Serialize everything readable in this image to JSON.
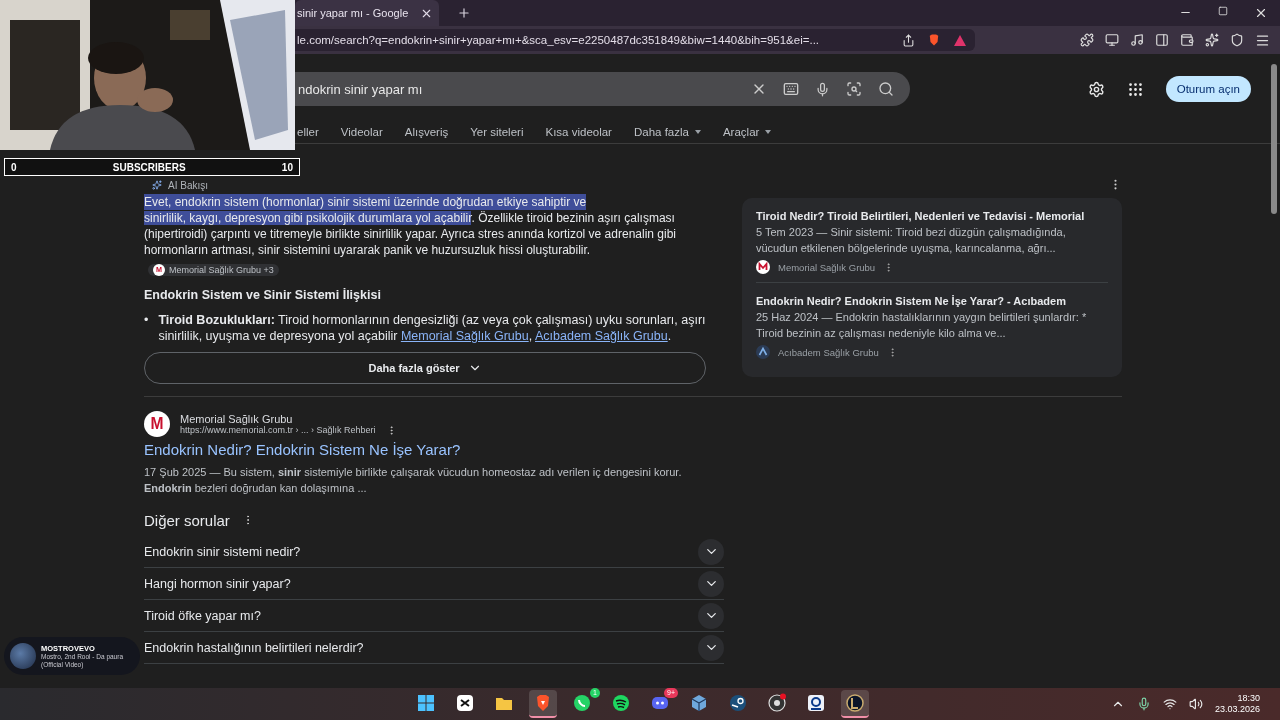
{
  "browser": {
    "tab": {
      "title": "sinir yapar mı - Google",
      "selected": true
    },
    "address": "le.com/search?q=endokrin+sinir+yapar+mı+&sca_esv=e2250487dc351849&biw=1440&bih=951&ei=..."
  },
  "search": {
    "query": "ndokrin sinir yapar mı",
    "sign_in": "Oturum açın"
  },
  "filters": [
    {
      "label": "eller",
      "dropdown": false
    },
    {
      "label": "Videolar",
      "dropdown": false
    },
    {
      "label": "Alışveriş",
      "dropdown": false
    },
    {
      "label": "Yer siteleri",
      "dropdown": false
    },
    {
      "label": "Kısa videolar",
      "dropdown": false
    },
    {
      "label": "Daha fazla",
      "dropdown": true
    },
    {
      "label": "Araçlar",
      "dropdown": true
    }
  ],
  "ai_overview": {
    "label": "AI Bakışı",
    "selected_lines": [
      "Evet, endokrin sistem (hormonlar) sinir sistemi üzerinde doğrudan etkiye sahiptir ve",
      "sinirlilik, kaygı, depresyon gibi psikolojik durumlara yol açabilir"
    ],
    "text": ". Özellikle tiroid bezinin aşırı çalışması (hipertiroidi) çarpıntı ve titremeyle birlikte sinirlilik yapar. Ayrıca stres anında kortizol ve adrenalin gibi hormonların artması, sinir sistemini uyararak panik ve huzursuzluk hissi oluşturabilir.",
    "chip": {
      "logo": "M",
      "label": "Memorial Sağlık Grubu +3"
    },
    "heading": "Endokrin Sistem ve Sinir Sistemi İlişkisi",
    "bullets": [
      {
        "marker": "•",
        "text": "**Tiroid Bozuklukları:** Tiroid hormonlarının dengesizliği (az veya çok çalışması) uyku sorunları, aşırı sinirlilik, uyuşma ve depresyona yol açabilir",
        "links": [
          {
            "label": "Memorial Sağlık Grubu",
            "after": ","
          },
          {
            "label": "Acıbadem Sağlık Grubu",
            "after": "."
          }
        ]
      }
    ],
    "more": "Daha fazla göster"
  },
  "sources": [
    {
      "title": "Tiroid Nedir? Tiroid Belirtileri, Nedenleri ve Tedavisi - Memorial",
      "snippet": "5 Tem 2023 — Sinir sistemi: Tiroid bezi düzgün çalışmadığında, vücudun etkilenen bölgelerinde uyuşma, karıncalanma, ağrı...",
      "site": "Memorial Sağlık Grubu",
      "kind": "memorial"
    },
    {
      "title": "Endokrin Nedir? Endokrin Sistem Ne İşe Yarar? - Acıbadem",
      "snippet": "25 Haz 2024 — Endokrin hastalıklarının yaygın belirtileri şunlardır: * Tiroid bezinin az çalışması nedeniyle kilo alma ve...",
      "site": "Acıbadem Sağlık Grubu",
      "kind": "acibadem"
    }
  ],
  "result": {
    "logo": "M",
    "site": "Memorial Sağlık Grubu",
    "url": "https://www.memorial.com.tr › ... › Sağlık Rehberi",
    "title": "Endokrin Nedir? Endokrin Sistem Ne İşe Yarar?",
    "snippet": "17 Şub 2025 — Bu sistem, **sinir** sistemiyle birlikte çalışarak vücudun homeostaz adı verilen iç dengesini korur. **Endokrin** bezleri doğrudan kan dolaşımına ..."
  },
  "other_questions": {
    "title": "Diğer sorular",
    "items": [
      {
        "question": "Endokrin sinir sistemi nedir?",
        "expanded": false
      },
      {
        "question": "Hangi hormon sinir yapar?",
        "expanded": false
      },
      {
        "question": "Tiroid öfke yapar mı?",
        "expanded": false
      },
      {
        "question": "Endokrin hastalığının belirtileri nelerdir?",
        "expanded": false
      }
    ]
  },
  "stream_overlay": {
    "subscribers": {
      "start": "0",
      "label": "SUBSCRIBERS",
      "goal": "10",
      "level": 0
    },
    "now_playing": {
      "artist": "MOSTROVEVO",
      "track": "Mostro, 2nd Rool - Da paura (Official Video)"
    }
  },
  "taskbar": {
    "apps": [
      {
        "kind": "windows",
        "active": false
      },
      {
        "kind": "capcut",
        "active": false
      },
      {
        "kind": "folder",
        "active": false
      },
      {
        "kind": "brave",
        "active": true
      },
      {
        "kind": "whatsapp",
        "active": false,
        "badge": "1"
      },
      {
        "kind": "spotify",
        "active": false
      },
      {
        "kind": "discord",
        "active": false,
        "badge": "9+"
      },
      {
        "kind": "cube",
        "active": false
      },
      {
        "kind": "steam",
        "active": false
      },
      {
        "kind": "obs",
        "active": false
      },
      {
        "kind": "camera",
        "active": false
      },
      {
        "kind": "league",
        "active": true
      }
    ],
    "time": "18:30",
    "date": "23.03.2026"
  }
}
